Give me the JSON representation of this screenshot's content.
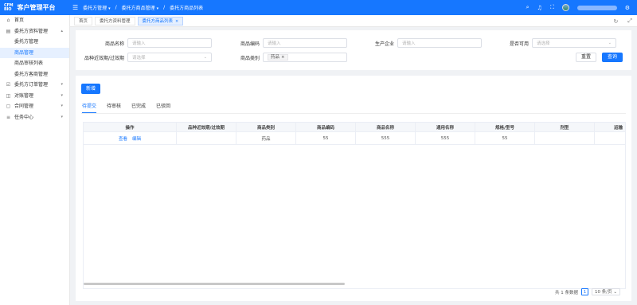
{
  "app": {
    "logo_text": "CFM\nBIO",
    "title": "客户管理平台"
  },
  "topnav": {
    "items": [
      {
        "label": "委托方管理"
      },
      {
        "label": "委托方商品管理"
      },
      {
        "label": "委托方商品列表"
      }
    ]
  },
  "header_icons": [
    "search-icon",
    "bell-icon",
    "fullscreen-icon",
    "settings-icon"
  ],
  "sidebar": {
    "items": [
      {
        "label": "首页",
        "icon": "home-icon",
        "level": 0
      },
      {
        "label": "委托方资料管理",
        "icon": "folder-icon",
        "level": 0,
        "expanded": true
      },
      {
        "label": "委托方管理",
        "level": 1
      },
      {
        "label": "商品管理",
        "level": 1,
        "active": true
      },
      {
        "label": "商品审核列表",
        "level": 1
      },
      {
        "label": "委托方客商管理",
        "level": 1
      },
      {
        "label": "委托方订单管理",
        "icon": "order-icon",
        "level": 0
      },
      {
        "label": "对账管理",
        "icon": "reconcile-icon",
        "level": 0
      },
      {
        "label": "合同管理",
        "icon": "contract-icon",
        "level": 0
      },
      {
        "label": "任务中心",
        "icon": "task-icon",
        "level": 0
      }
    ]
  },
  "page_tabs": [
    {
      "label": "首页"
    },
    {
      "label": "委托方资料管理"
    },
    {
      "label": "委托方商品列表",
      "active": true,
      "close": "×"
    }
  ],
  "search": {
    "product_name": {
      "label": "商品名称",
      "placeholder": "请输入"
    },
    "product_code": {
      "label": "商品编码",
      "placeholder": "请输入"
    },
    "manufacturer": {
      "label": "生产企业",
      "placeholder": "请输入"
    },
    "available": {
      "label": "是否可用",
      "placeholder": "请选择"
    },
    "expiry": {
      "label": "品种近效期/过效期",
      "placeholder": "请选择"
    },
    "category": {
      "label": "商品类别",
      "value": "药品",
      "chip_close": "×"
    },
    "reset_label": "重置",
    "search_label": "查询"
  },
  "actions": {
    "add_label": "新增"
  },
  "status_tabs": [
    {
      "label": "待提交",
      "active": true
    },
    {
      "label": "待审核"
    },
    {
      "label": "已完成"
    },
    {
      "label": "已驳回"
    }
  ],
  "table": {
    "columns": [
      "操作",
      "品种近效期/过效期",
      "商品类别",
      "商品编码",
      "商品名称",
      "通用名称",
      "规格/型号",
      "剂型",
      "运输"
    ],
    "rows": [
      {
        "actions": [
          "查看",
          "编辑"
        ],
        "expiry": "",
        "category": "药品",
        "code": "55",
        "name": "555",
        "common_name": "555",
        "spec": "55",
        "dosage_form": "",
        "transport": ""
      }
    ]
  },
  "pagination": {
    "total_text": "共 1 条数据",
    "current_page": "1",
    "page_size": "10 条/页"
  },
  "colors": {
    "primary": "#1677ff",
    "sidebar_active_bg": "#e6f0ff",
    "page_bg": "#f0f2f5"
  }
}
